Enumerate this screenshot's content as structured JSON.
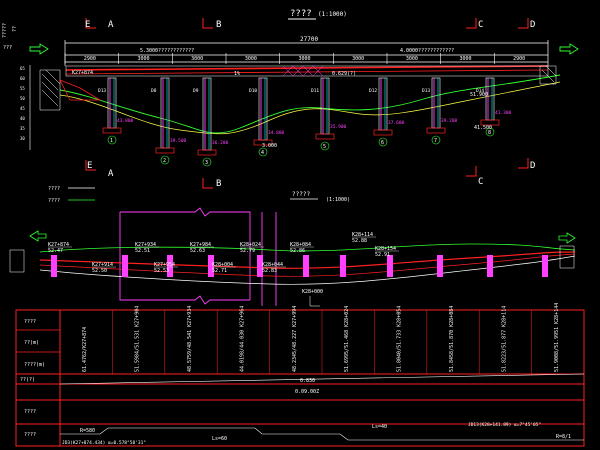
{
  "colors": {
    "background": "#000000",
    "line_white": "#ffffff",
    "red": "#ff2020",
    "cyan": "#00e0e0",
    "green": "#30ff30",
    "magenta": "#ff40ff",
    "yellow": "#ffff40",
    "blue": "#4080ff"
  },
  "titles": {
    "elevation": "????",
    "elevation_scale": "(1:1000)",
    "plan": "?????",
    "plan_scale": "(1:1000)"
  },
  "section_marks": [
    "E",
    "A",
    "B",
    "B",
    "C",
    "D",
    "E",
    "A",
    "B",
    "C",
    "D"
  ],
  "dims": {
    "total": "27700",
    "span_segments": [
      "2900",
      "3000",
      "3000",
      "3000",
      "3000",
      "3000",
      "3000",
      "3000",
      "2900"
    ],
    "top_left_label": "5.3000????????????",
    "top_right_label": "4.0000????????????"
  },
  "elevation_labels": {
    "left_station": "K27+874",
    "bridge_elev_mid": "0.629(?)",
    "level_1": "51.900",
    "level_2": "41.500",
    "level_3": "3.000",
    "pier_tags": [
      "D13",
      "D8",
      "D9",
      "D10",
      "D11",
      "D12",
      "D13",
      "D14"
    ],
    "pier_numbers": [
      "1",
      "2",
      "3",
      "4",
      "5",
      "6",
      "7",
      "8"
    ],
    "elev_vals": [
      "43.000",
      "39.500",
      "36.200",
      "34.800",
      "35.900",
      "37.600",
      "39.200",
      "41.300"
    ]
  },
  "legend": {
    "row1": "????",
    "row2": "????"
  },
  "plan_stations": [
    "K27+874\n52.47",
    "K27+914\n52.50",
    "K27+934\n52.51",
    "K27+954\n52.53",
    "K27+984\n52.63",
    "K28+004\n52.71",
    "K28+024\n52.79",
    "K28+044\n52.83",
    "K28+084\n52.86",
    "K28+114\n52.88",
    "K28+154\n52.91"
  ],
  "plan_extra": {
    "mid_bottom": "K28+000\nS3.00",
    "right_tag": "K28+154\n52.91"
  },
  "table": {
    "row_labels": [
      "????",
      "??(m)",
      "????(m)",
      "??(?)",
      "????",
      "????"
    ],
    "row_columns": [
      "61.4762/K27+874",
      "51.5984/51.531 K27+904",
      "48.5759/48.541 K27+934",
      "44.0198/44.030 K27+964",
      "48.2345/48.227 K27+994",
      "51.6995/51.468 K28+024",
      "51.8040/51.733 K28+054",
      "51.8458/51.870 K28+084",
      "51.8223/51.877 K28+114",
      "51.9008/51.9951 K28+144"
    ],
    "gradient_value": "0.830",
    "gradient_sub": "0.09.00Z",
    "curve_left": "R=580",
    "curve_mid": "Ls=60",
    "curve_right": "R=8/1",
    "bottom_notes": [
      "JD3(K27+874.434) α=0.578°58'31\"",
      "Ls=60",
      "Ls=40",
      "JD13(K28+141.89) α=7°45'05\""
    ]
  },
  "arrows": {
    "left": "??",
    "right": "??"
  }
}
